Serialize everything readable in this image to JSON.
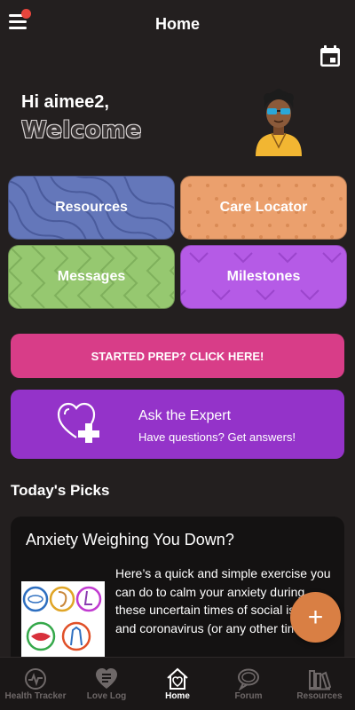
{
  "header": {
    "title": "Home",
    "menu_icon": "hamburger-menu-icon",
    "calendar_icon": "calendar-icon",
    "notification_dot_color": "#e8453c"
  },
  "greeting": {
    "hello": "Hi aimee2,",
    "welcome": "Welcome"
  },
  "tiles": [
    {
      "label": "Resources",
      "color": "#6477ba"
    },
    {
      "label": "Care Locator",
      "color": "#eba06d"
    },
    {
      "label": "Messages",
      "color": "#96c870"
    },
    {
      "label": "Milestones",
      "color": "#b55be6"
    }
  ],
  "prep_banner": {
    "label": "STARTED PREP? CLICK HERE!",
    "color": "#d83d88"
  },
  "expert": {
    "title": "Ask the Expert",
    "subtitle": "Have questions? Get answers!",
    "icon": "heart-plus-icon",
    "color": "#9433c9"
  },
  "picks": {
    "heading": "Today's Picks",
    "card": {
      "title": "Anxiety Weighing You Down?",
      "body": "Here’s a quick and simple exercise you can do to calm your anxiety during these uncertain times of social isolation and coronavirus (or any other time"
    }
  },
  "fab": {
    "label": "+",
    "color": "#d97f44"
  },
  "tabbar": {
    "active": "Home",
    "tabs": [
      {
        "label": "Health Tracker",
        "icon": "health-tracker-icon"
      },
      {
        "label": "Love Log",
        "icon": "love-log-icon"
      },
      {
        "label": "Home",
        "icon": "home-icon"
      },
      {
        "label": "Forum",
        "icon": "forum-icon"
      },
      {
        "label": "Resources",
        "icon": "resources-books-icon"
      }
    ]
  }
}
